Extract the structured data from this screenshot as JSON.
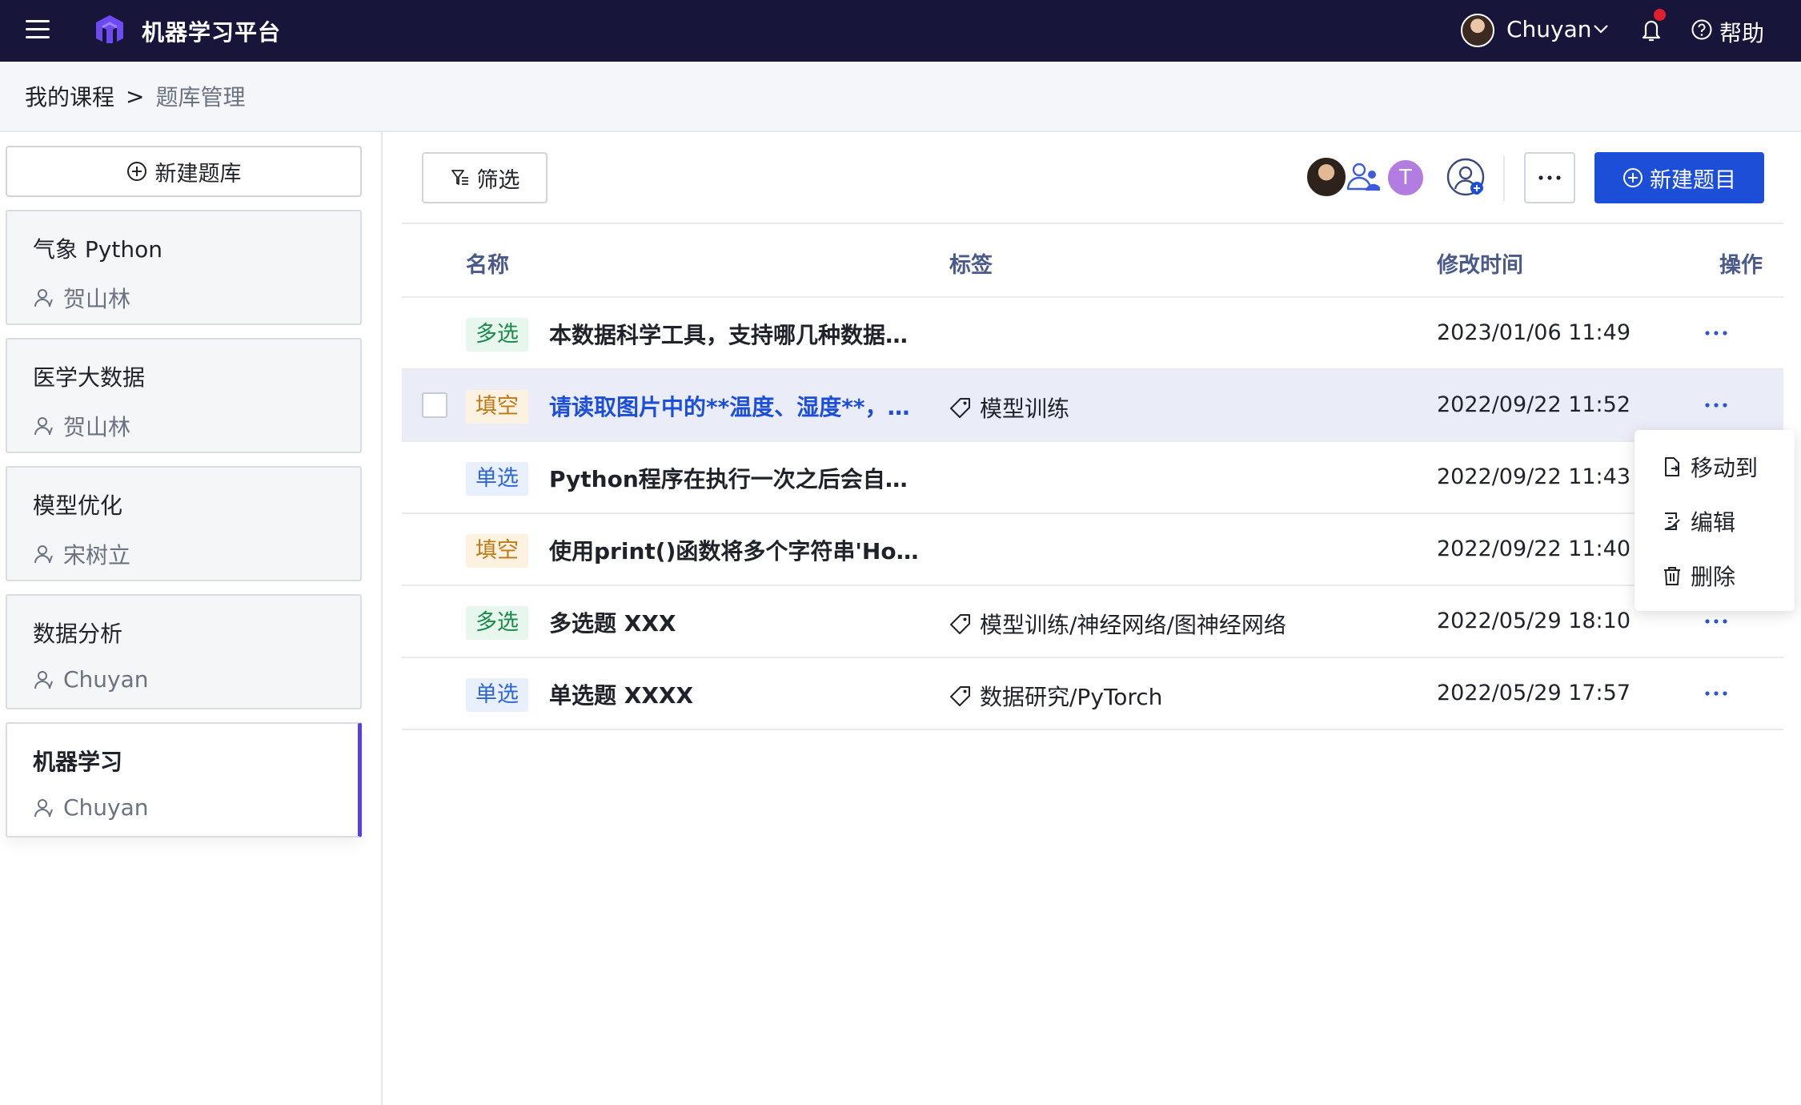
{
  "header": {
    "app_title": "机器学习平台",
    "user_name": "Chuyan",
    "help_label": "帮助"
  },
  "breadcrumb": {
    "root": "我的课程",
    "separator": ">",
    "current": "题库管理"
  },
  "sidebar": {
    "new_bank_label": "新建题库",
    "banks": [
      {
        "name": "气象 Python",
        "owner": "贺山林"
      },
      {
        "name": "医学大数据",
        "owner": "贺山林"
      },
      {
        "name": "模型优化",
        "owner": "宋树立"
      },
      {
        "name": "数据分析",
        "owner": "Chuyan"
      },
      {
        "name": "机器学习",
        "owner": "Chuyan",
        "active": true
      }
    ]
  },
  "toolbar": {
    "filter_label": "筛选",
    "collaborator_letter": "T",
    "new_question_label": "新建题目"
  },
  "table": {
    "columns": [
      "名称",
      "标签",
      "修改时间",
      "操作"
    ],
    "rows": [
      {
        "type": "多选",
        "name": "本数据科学工具，支持哪几种数据…",
        "tag": "",
        "time": "2023/01/06 11:49"
      },
      {
        "type": "填空",
        "name": "请读取图片中的**温度、湿度**，…",
        "tag": "模型训练",
        "time": "2022/09/22 11:52"
      },
      {
        "type": "单选",
        "name": "Python程序在执行一次之后会自…",
        "tag": "",
        "time": "2022/09/22 11:43"
      },
      {
        "type": "填空",
        "name": "使用print()函数将多个字符串'Ho…",
        "tag": "",
        "time": "2022/09/22 11:40"
      },
      {
        "type": "多选",
        "name": "多选题 XXX",
        "tag": "模型训练/神经网络/图神经网络",
        "time": "2022/05/29 18:10"
      },
      {
        "type": "单选",
        "name": "单选题 XXXX",
        "tag": "数据研究/PyTorch",
        "time": "2022/05/29 17:57"
      }
    ]
  },
  "row_menu": {
    "items": [
      "移动到",
      "编辑",
      "删除"
    ]
  },
  "colors": {
    "topbar": "#17153a",
    "primary": "#1d4ed8",
    "active_bank_accent": "#5a3fe0",
    "notification_dot": "#e0202f"
  }
}
